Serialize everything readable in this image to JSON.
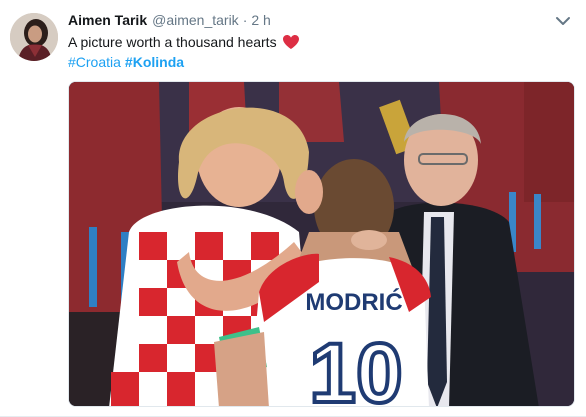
{
  "tweet": {
    "author": {
      "display_name": "Aimen Tarik",
      "handle": "@aimen_tarik",
      "avatar_icon": "user-avatar"
    },
    "separator": "·",
    "timestamp": "2 h",
    "text_line": "A picture worth a thousand hearts",
    "emoji": "red-heart",
    "hashtags": [
      "#Croatia",
      "#Kolinda"
    ],
    "menu_icon": "chevron-down-icon",
    "media": {
      "jersey_name": "MODRIĆ",
      "jersey_number": "10"
    }
  },
  "colors": {
    "link": "#1da1f2",
    "text": "#14171a",
    "muted": "#657786",
    "heart": "#e0245e"
  }
}
